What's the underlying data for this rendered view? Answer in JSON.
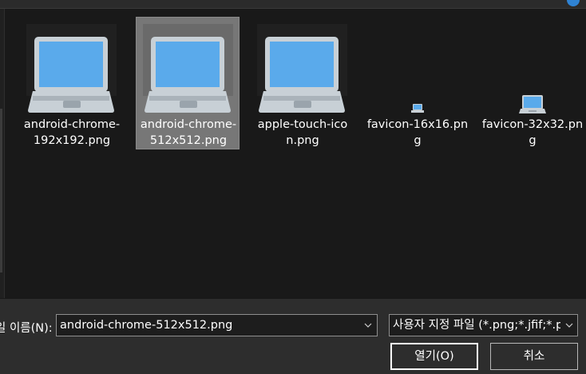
{
  "files": [
    {
      "name": "android-chrome-192x192.png",
      "line1": "android-chrome-",
      "line2": "192x192.png",
      "icon": "laptop-icon",
      "size": "large",
      "selected": false
    },
    {
      "name": "android-chrome-512x512.png",
      "line1": "android-chrome-",
      "line2": "512x512.png",
      "icon": "laptop-icon",
      "size": "large",
      "selected": true
    },
    {
      "name": "apple-touch-icon.png",
      "line1": "apple-touch-ico",
      "line2": "n.png",
      "icon": "laptop-icon",
      "size": "large",
      "selected": false
    },
    {
      "name": "favicon-16x16.png",
      "line1": "favicon-16x16.pn",
      "line2": "g",
      "icon": "laptop-icon",
      "size": "tiny",
      "selected": false
    },
    {
      "name": "favicon-32x32.png",
      "line1": "favicon-32x32.pn",
      "line2": "g",
      "icon": "laptop-icon",
      "size": "small",
      "selected": false
    }
  ],
  "footer": {
    "filename_label": "일 이름(N):",
    "filename_value": "android-chrome-512x512.png",
    "filetype_value": "사용자 지정 파일 (*.png;*.jfif;*.pjpeg;*.jpeg;*.pjp;*.jpg)",
    "open_label": "열기(O)",
    "cancel_label": "취소"
  },
  "colors": {
    "background": "#191919",
    "footer": "#2d2d2d",
    "selection": "#777777",
    "laptop_screen": "#5aaaeb",
    "laptop_body": "#c8d0d6"
  }
}
